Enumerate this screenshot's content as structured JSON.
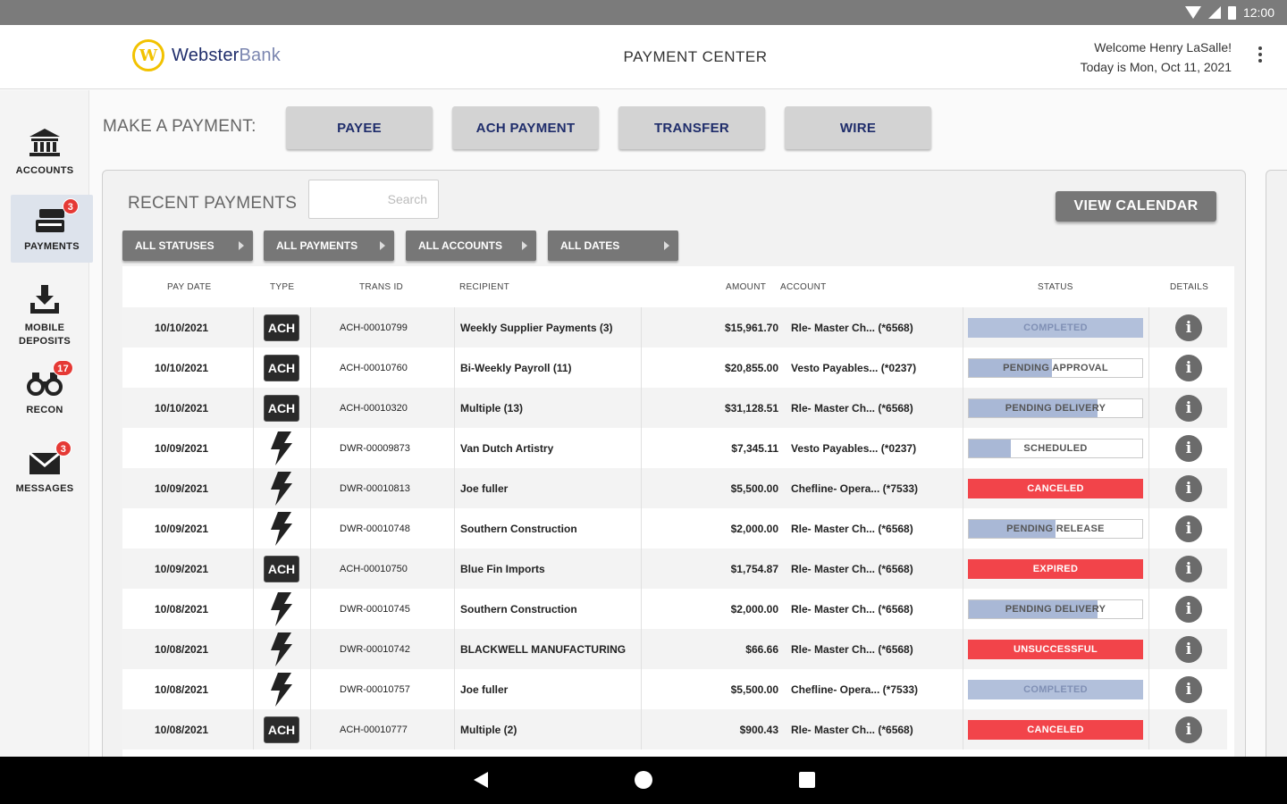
{
  "status_bar": {
    "time": "12:00"
  },
  "header": {
    "logo_text_bold": "Webster",
    "logo_text_light": "Bank",
    "title": "PAYMENT CENTER",
    "welcome": "Welcome Henry LaSalle!",
    "date": "Today is Mon, Oct 11, 2021"
  },
  "nav": [
    {
      "label": "ACCOUNTS",
      "badge": ""
    },
    {
      "label": "PAYMENTS",
      "badge": "3"
    },
    {
      "label_line1": "MOBILE",
      "label_line2": "DEPOSITS",
      "badge": ""
    },
    {
      "label": "RECON",
      "badge": "17"
    },
    {
      "label": "MESSAGES",
      "badge": "3"
    }
  ],
  "make_payment": {
    "label": "MAKE A PAYMENT:",
    "buttons": [
      "PAYEE",
      "ACH PAYMENT",
      "TRANSFER",
      "WIRE"
    ]
  },
  "recent": {
    "label": "RECENT PAYMENTS",
    "search_placeholder": "Search",
    "view_calendar": "VIEW CALENDAR",
    "filters": [
      "ALL STATUSES",
      "ALL PAYMENTS",
      "ALL ACCOUNTS",
      "ALL DATES"
    ],
    "columns": [
      "PAY DATE",
      "TYPE",
      "TRANS ID",
      "RECIPIENT",
      "AMOUNT",
      "ACCOUNT",
      "STATUS",
      "DETAILS"
    ],
    "rows": [
      {
        "date": "10/10/2021",
        "type": "ACH",
        "trans_id": "ACH-00010799",
        "recipient": "Weekly Supplier Payments (3)",
        "amount": "$15,961.70",
        "account": "Rle- Master Ch... (*6568)",
        "status": "COMPLETED",
        "style": "full",
        "progress": 1.0
      },
      {
        "date": "10/10/2021",
        "type": "ACH",
        "trans_id": "ACH-00010760",
        "recipient": "Bi-Weekly Payroll (11)",
        "amount": "$20,855.00",
        "account": "Vesto Payables... (*0237)",
        "status": "PENDING APPROVAL",
        "style": "progress",
        "progress": 0.48
      },
      {
        "date": "10/10/2021",
        "type": "ACH",
        "trans_id": "ACH-00010320",
        "recipient": "Multiple (13)",
        "amount": "$31,128.51",
        "account": "Rle- Master Ch... (*6568)",
        "status": "PENDING DELIVERY",
        "style": "progress",
        "progress": 0.74
      },
      {
        "date": "10/09/2021",
        "type": "WIRE",
        "trans_id": "DWR-00009873",
        "recipient": "Van Dutch Artistry",
        "amount": "$7,345.11",
        "account": "Vesto Payables... (*0237)",
        "status": "SCHEDULED",
        "style": "progress",
        "progress": 0.24
      },
      {
        "date": "10/09/2021",
        "type": "WIRE",
        "trans_id": "DWR-00010813",
        "recipient": "Joe fuller",
        "amount": "$5,500.00",
        "account": "Chefline- Opera... (*7533)",
        "status": "CANCELED",
        "style": "red",
        "progress": 1.0
      },
      {
        "date": "10/09/2021",
        "type": "WIRE",
        "trans_id": "DWR-00010748",
        "recipient": "Southern Construction",
        "amount": "$2,000.00",
        "account": "Rle- Master Ch... (*6568)",
        "status": "PENDING RELEASE",
        "style": "progress",
        "progress": 0.5
      },
      {
        "date": "10/09/2021",
        "type": "ACH",
        "trans_id": "ACH-00010750",
        "recipient": "Blue Fin Imports",
        "amount": "$1,754.87",
        "account": "Rle- Master Ch... (*6568)",
        "status": "EXPIRED",
        "style": "red",
        "progress": 1.0
      },
      {
        "date": "10/08/2021",
        "type": "WIRE",
        "trans_id": "DWR-00010745",
        "recipient": "Southern Construction",
        "amount": "$2,000.00",
        "account": "Rle- Master Ch... (*6568)",
        "status": "PENDING DELIVERY",
        "style": "progress",
        "progress": 0.74
      },
      {
        "date": "10/08/2021",
        "type": "WIRE",
        "trans_id": "DWR-00010742",
        "recipient": "BLACKWELL MANUFACTURING",
        "amount": "$66.66",
        "account": "Rle- Master Ch... (*6568)",
        "status": "UNSUCCESSFUL",
        "style": "red",
        "progress": 1.0
      },
      {
        "date": "10/08/2021",
        "type": "WIRE",
        "trans_id": "DWR-00010757",
        "recipient": "Joe fuller",
        "amount": "$5,500.00",
        "account": "Chefline- Opera... (*7533)",
        "status": "COMPLETED",
        "style": "full",
        "progress": 1.0
      },
      {
        "date": "10/08/2021",
        "type": "ACH",
        "trans_id": "ACH-00010777",
        "recipient": "Multiple (2)",
        "amount": "$900.43",
        "account": "Rle- Master Ch... (*6568)",
        "status": "CANCELED",
        "style": "red",
        "progress": 1.0
      }
    ]
  },
  "colors": {
    "brand_navy": "#1f2d6b",
    "brand_gold": "#f2c200",
    "status_red": "#f2444a",
    "status_blue": "#a9b8d6"
  }
}
